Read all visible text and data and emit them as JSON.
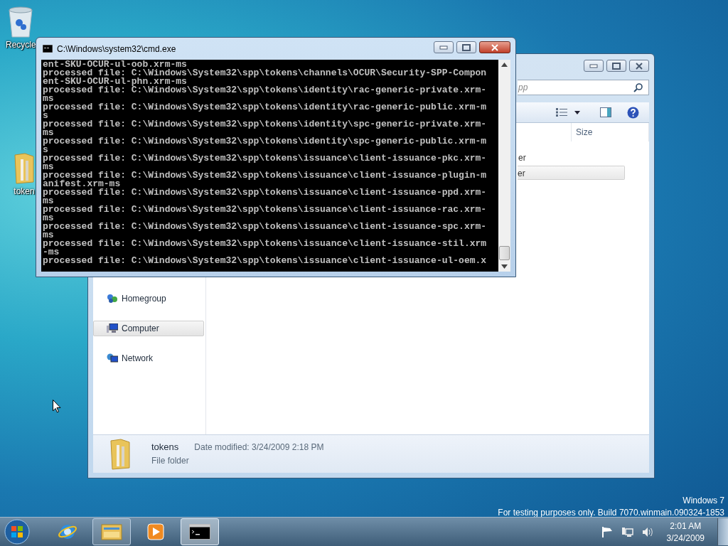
{
  "desktop_icons": [
    {
      "label": "Recycle",
      "kind": "recycle"
    },
    {
      "label": "token",
      "kind": "folder"
    }
  ],
  "explorer": {
    "search": {
      "placeholder": "pp"
    },
    "columns": [
      "Size"
    ],
    "rows": [
      {
        "label": "er",
        "selected": false
      },
      {
        "label": "er",
        "selected": true
      }
    ],
    "nav": [
      {
        "label": "Homegroup",
        "kind": "homegroup",
        "selected": false
      },
      {
        "label": "Computer",
        "kind": "computer",
        "selected": true
      },
      {
        "label": "Network",
        "kind": "network",
        "selected": false
      }
    ],
    "details": {
      "name": "tokens",
      "modified": "Date modified: 3/24/2009 2:18 PM",
      "type": "File folder"
    }
  },
  "cmd": {
    "title": "C:\\Windows\\system32\\cmd.exe",
    "lines": [
      "ent-SKU-OCUR-ul-oob.xrm-ms",
      "processed file: C:\\Windows\\System32\\spp\\tokens\\channels\\OCUR\\Security-SPP-Compon",
      "ent-SKU-OCUR-ul-phn.xrm-ms",
      "processed file: C:\\Windows\\System32\\spp\\tokens\\identity\\rac-generic-private.xrm-",
      "ms",
      "processed file: C:\\Windows\\System32\\spp\\tokens\\identity\\rac-generic-public.xrm-m",
      "s",
      "processed file: C:\\Windows\\System32\\spp\\tokens\\identity\\spc-generic-private.xrm-",
      "ms",
      "processed file: C:\\Windows\\System32\\spp\\tokens\\identity\\spc-generic-public.xrm-m",
      "s",
      "processed file: C:\\Windows\\System32\\spp\\tokens\\issuance\\client-issuance-pkc.xrm-",
      "ms",
      "processed file: C:\\Windows\\System32\\spp\\tokens\\issuance\\client-issuance-plugin-m",
      "anifest.xrm-ms",
      "processed file: C:\\Windows\\System32\\spp\\tokens\\issuance\\client-issuance-ppd.xrm-",
      "ms",
      "processed file: C:\\Windows\\System32\\spp\\tokens\\issuance\\client-issuance-rac.xrm-",
      "ms",
      "processed file: C:\\Windows\\System32\\spp\\tokens\\issuance\\client-issuance-spc.xrm-",
      "ms",
      "processed file: C:\\Windows\\System32\\spp\\tokens\\issuance\\client-issuance-stil.xrm",
      "-ms",
      "processed file: C:\\Windows\\System32\\spp\\tokens\\issuance\\client-issuance-ul-oem.x"
    ]
  },
  "watermark": [
    "Windows 7",
    "For testing purposes only. Build 7070.winmain.090324-1853"
  ],
  "taskbar": {
    "items": [
      {
        "kind": "ie",
        "running": false,
        "selected": false
      },
      {
        "kind": "explorer",
        "running": true,
        "selected": false
      },
      {
        "kind": "media",
        "running": false,
        "selected": false
      },
      {
        "kind": "cmd",
        "running": true,
        "selected": true
      }
    ],
    "clock": {
      "time": "2:01 AM",
      "date": "3/24/2009"
    }
  }
}
